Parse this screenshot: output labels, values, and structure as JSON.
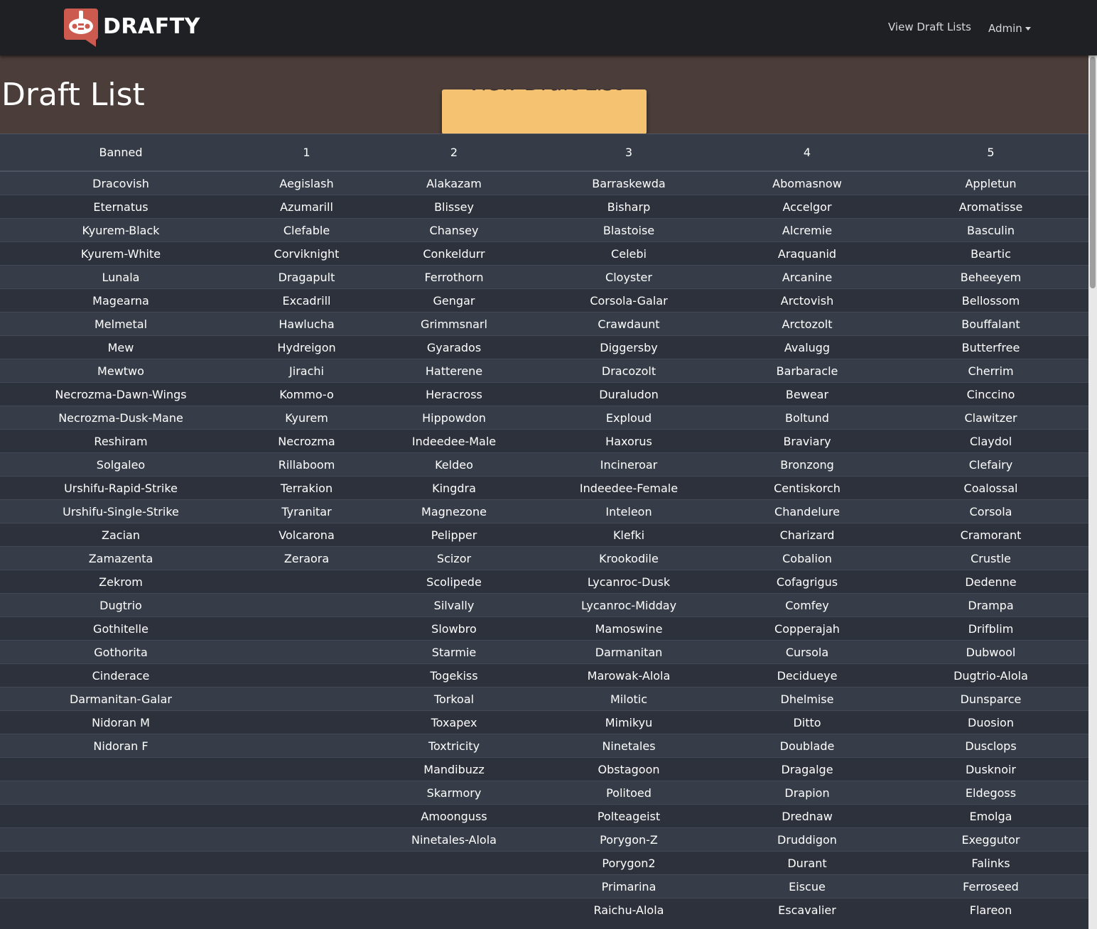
{
  "navbar": {
    "brand": "DRAFTY",
    "links": {
      "view_draft_lists": "View Draft Lists",
      "admin": "Admin"
    }
  },
  "hero": {
    "button_label": "View Draft List",
    "title": "Draft List"
  },
  "table": {
    "headers": [
      "Banned",
      "1",
      "2",
      "3",
      "4",
      "5"
    ],
    "rows": [
      [
        "Dracovish",
        "Aegislash",
        "Alakazam",
        "Barraskewda",
        "Abomasnow",
        "Appletun"
      ],
      [
        "Eternatus",
        "Azumarill",
        "Blissey",
        "Bisharp",
        "Accelgor",
        "Aromatisse"
      ],
      [
        "Kyurem-Black",
        "Clefable",
        "Chansey",
        "Blastoise",
        "Alcremie",
        "Basculin"
      ],
      [
        "Kyurem-White",
        "Corviknight",
        "Conkeldurr",
        "Celebi",
        "Araquanid",
        "Beartic"
      ],
      [
        "Lunala",
        "Dragapult",
        "Ferrothorn",
        "Cloyster",
        "Arcanine",
        "Beheeyem"
      ],
      [
        "Magearna",
        "Excadrill",
        "Gengar",
        "Corsola-Galar",
        "Arctovish",
        "Bellossom"
      ],
      [
        "Melmetal",
        "Hawlucha",
        "Grimmsnarl",
        "Crawdaunt",
        "Arctozolt",
        "Bouffalant"
      ],
      [
        "Mew",
        "Hydreigon",
        "Gyarados",
        "Diggersby",
        "Avalugg",
        "Butterfree"
      ],
      [
        "Mewtwo",
        "Jirachi",
        "Hatterene",
        "Dracozolt",
        "Barbaracle",
        "Cherrim"
      ],
      [
        "Necrozma-Dawn-Wings",
        "Kommo-o",
        "Heracross",
        "Duraludon",
        "Bewear",
        "Cinccino"
      ],
      [
        "Necrozma-Dusk-Mane",
        "Kyurem",
        "Hippowdon",
        "Exploud",
        "Boltund",
        "Clawitzer"
      ],
      [
        "Reshiram",
        "Necrozma",
        "Indeedee-Male",
        "Haxorus",
        "Braviary",
        "Claydol"
      ],
      [
        "Solgaleo",
        "Rillaboom",
        "Keldeo",
        "Incineroar",
        "Bronzong",
        "Clefairy"
      ],
      [
        "Urshifu-Rapid-Strike",
        "Terrakion",
        "Kingdra",
        "Indeedee-Female",
        "Centiskorch",
        "Coalossal"
      ],
      [
        "Urshifu-Single-Strike",
        "Tyranitar",
        "Magnezone",
        "Inteleon",
        "Chandelure",
        "Corsola"
      ],
      [
        "Zacian",
        "Volcarona",
        "Pelipper",
        "Klefki",
        "Charizard",
        "Cramorant"
      ],
      [
        "Zamazenta",
        "Zeraora",
        "Scizor",
        "Krookodile",
        "Cobalion",
        "Crustle"
      ],
      [
        "Zekrom",
        "",
        "Scolipede",
        "Lycanroc-Dusk",
        "Cofagrigus",
        "Dedenne"
      ],
      [
        "Dugtrio",
        "",
        "Silvally",
        "Lycanroc-Midday",
        "Comfey",
        "Drampa"
      ],
      [
        "Gothitelle",
        "",
        "Slowbro",
        "Mamoswine",
        "Copperajah",
        "Drifblim"
      ],
      [
        "Gothorita",
        "",
        "Starmie",
        "Darmanitan",
        "Cursola",
        "Dubwool"
      ],
      [
        "Cinderace",
        "",
        "Togekiss",
        "Marowak-Alola",
        "Decidueye",
        "Dugtrio-Alola"
      ],
      [
        "Darmanitan-Galar",
        "",
        "Torkoal",
        "Milotic",
        "Dhelmise",
        "Dunsparce"
      ],
      [
        "Nidoran M",
        "",
        "Toxapex",
        "Mimikyu",
        "Ditto",
        "Duosion"
      ],
      [
        "Nidoran F",
        "",
        "Toxtricity",
        "Ninetales",
        "Doublade",
        "Dusclops"
      ],
      [
        "",
        "",
        "Mandibuzz",
        "Obstagoon",
        "Dragalge",
        "Dusknoir"
      ],
      [
        "",
        "",
        "Skarmory",
        "Politoed",
        "Drapion",
        "Eldegoss"
      ],
      [
        "",
        "",
        "Amoonguss",
        "Polteageist",
        "Drednaw",
        "Emolga"
      ],
      [
        "",
        "",
        "Ninetales-Alola",
        "Porygon-Z",
        "Druddigon",
        "Exeggutor"
      ],
      [
        "",
        "",
        "",
        "Porygon2",
        "Durant",
        "Falinks"
      ],
      [
        "",
        "",
        "",
        "Primarina",
        "Eiscue",
        "Ferroseed"
      ],
      [
        "",
        "",
        "",
        "Raichu-Alola",
        "Escavalier",
        "Flareon"
      ]
    ]
  }
}
